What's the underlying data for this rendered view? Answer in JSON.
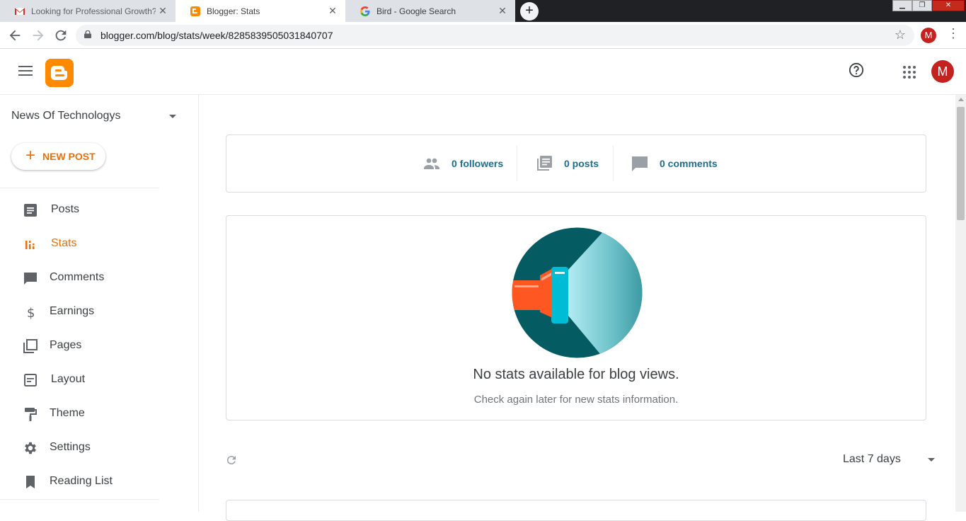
{
  "browser": {
    "tabs": [
      {
        "title": "Looking for Professional Growth? S",
        "favicon": "gmail-icon"
      },
      {
        "title": "Blogger: Stats",
        "favicon": "blogger-icon"
      },
      {
        "title": "Bird - Google Search",
        "favicon": "google-icon"
      }
    ],
    "close_glyph": "✕",
    "new_tab_glyph": "+",
    "url": "blogger.com/blog/stats/week/8285839505031840707",
    "profile_initial": "M"
  },
  "header": {
    "avatar_initial": "M"
  },
  "sidebar": {
    "blog_name": "News Of Technologys",
    "new_post_label": "NEW POST",
    "items": [
      {
        "label": "Posts",
        "icon": "posts-icon"
      },
      {
        "label": "Stats",
        "icon": "stats-icon"
      },
      {
        "label": "Comments",
        "icon": "comments-icon"
      },
      {
        "label": "Earnings",
        "icon": "dollar-icon"
      },
      {
        "label": "Pages",
        "icon": "pages-icon"
      },
      {
        "label": "Layout",
        "icon": "layout-icon"
      },
      {
        "label": "Theme",
        "icon": "paint-roller-icon"
      },
      {
        "label": "Settings",
        "icon": "gear-icon"
      },
      {
        "label": "Reading List",
        "icon": "bookmark-icon"
      }
    ],
    "active_item": "Stats"
  },
  "main": {
    "summary": {
      "followers": "0 followers",
      "posts": "0 posts",
      "comments": "0 comments"
    },
    "views": {
      "title": "No stats available for blog views.",
      "subtitle": "Check again later for new stats information."
    },
    "range_label": "Last 7 days"
  },
  "colors": {
    "accent": "#e8710a",
    "brand": "#ff8a00",
    "link": "#1a6e8e"
  }
}
